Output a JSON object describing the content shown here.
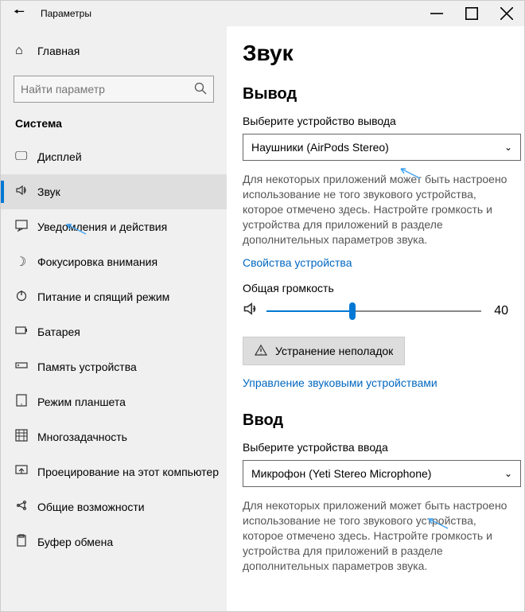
{
  "titlebar": {
    "title": "Параметры"
  },
  "sidebar": {
    "home": "Главная",
    "search_placeholder": "Найти параметр",
    "section": "Система",
    "items": [
      {
        "label": "Дисплей"
      },
      {
        "label": "Звук"
      },
      {
        "label": "Уведомления и действия"
      },
      {
        "label": "Фокусировка внимания"
      },
      {
        "label": "Питание и спящий режим"
      },
      {
        "label": "Батарея"
      },
      {
        "label": "Память устройства"
      },
      {
        "label": "Режим планшета"
      },
      {
        "label": "Многозадачность"
      },
      {
        "label": "Проецирование на этот компьютер"
      },
      {
        "label": "Общие возможности"
      },
      {
        "label": "Буфер обмена"
      }
    ]
  },
  "content": {
    "page_title": "Звук",
    "output": {
      "heading": "Вывод",
      "select_label": "Выберите устройство вывода",
      "selected": "Наушники (AirPods Stereo)",
      "description": "Для некоторых приложений может быть настроено использование не того звукового устройства, которое отмечено здесь. Настройте громкость и устройства для приложений в разделе дополнительных параметров звука.",
      "properties_link": "Свойства устройства",
      "volume_label": "Общая громкость",
      "volume_value": "40",
      "troubleshoot": "Устранение неполадок",
      "manage_link": "Управление звуковыми устройствами"
    },
    "input": {
      "heading": "Ввод",
      "select_label": "Выберите устройства ввода",
      "selected": "Микрофон (Yeti Stereo Microphone)",
      "description": "Для некоторых приложений может быть настроено использование не того звукового устройства, которое отмечено здесь. Настройте громкость и устройства для приложений в разделе дополнительных параметров звука."
    }
  }
}
